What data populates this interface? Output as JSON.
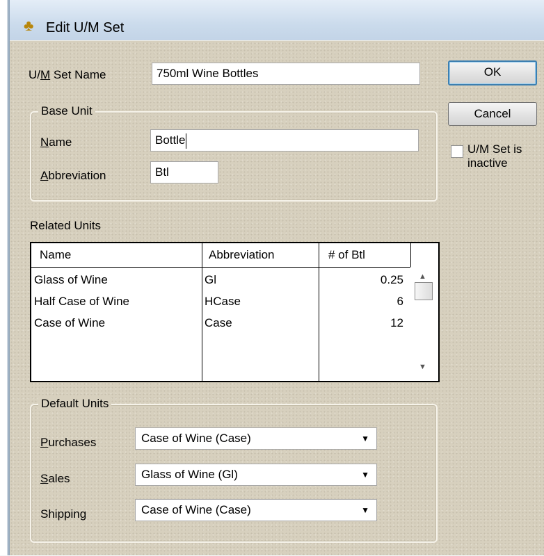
{
  "window": {
    "title": "Edit U/M Set",
    "icon": "units-icon"
  },
  "um_set_name": {
    "label_pre": "U/",
    "label_ul": "M",
    "label_post": " Set Name",
    "value": "750ml Wine Bottles"
  },
  "base_unit": {
    "legend": "Base Unit",
    "name_label_ul": "N",
    "name_label_post": "ame",
    "name_value": "Bottle",
    "abbr_label_ul": "A",
    "abbr_label_post": "bbreviation",
    "abbr_value": "Btl"
  },
  "buttons": {
    "ok": "OK",
    "cancel": "Cancel"
  },
  "inactive": {
    "line1": "U/M Set is",
    "line2": "inactive",
    "checked": false
  },
  "related_units": {
    "label": "Related Units",
    "columns": [
      "Name",
      "Abbreviation",
      "# of Btl"
    ],
    "rows": [
      {
        "name": "Glass of Wine",
        "abbr": "Gl",
        "qty": "0.25"
      },
      {
        "name": "Half Case of Wine",
        "abbr": "HCase",
        "qty": "6"
      },
      {
        "name": "Case of Wine",
        "abbr": "Case",
        "qty": "12"
      }
    ]
  },
  "default_units": {
    "legend": "Default Units",
    "purchases_ul": "P",
    "purchases_post": "urchases",
    "purchases_value": "Case of Wine (Case)",
    "sales_ul": "S",
    "sales_post": "ales",
    "sales_value": "Glass of Wine (Gl)",
    "shipping_pre": "Shippin",
    "shipping_ul": "g",
    "shipping_value": "Case of Wine (Case)"
  },
  "icons": {
    "dropdown": "▼",
    "scroll_up": "▲",
    "scroll_down": "▼"
  }
}
